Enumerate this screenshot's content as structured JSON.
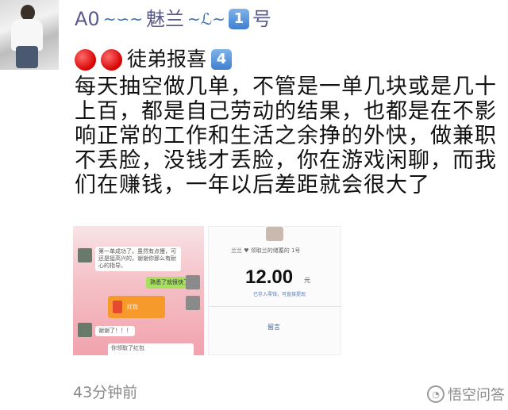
{
  "post": {
    "avatar_icon": "user-avatar-photo",
    "author": {
      "prefix": "A0",
      "deco1": "~∽~",
      "mid": "魅兰",
      "deco2": "~ℒ~",
      "number_badge": "1",
      "suffix": "号"
    },
    "tag": {
      "text": "徒弟报喜",
      "badge": "4"
    },
    "body_lines": [
      "每天抽空做几单，不管是一单几块或是几十",
      "上百，都是自己劳动的结果，也都是在不影",
      "响正常的工作和生活之余挣的外快，做兼职",
      "不丢脸，没钱才丢脸，你在游戏闲聊，而我",
      "们在赚钱，一年以后差距就会很大了"
    ],
    "images": {
      "left": {
        "top_text": "第一单成功了。虽然有点慢，可还是挺高兴的，谢谢你那么有耐心的指导。",
        "green_text": "熟悉了就很快了",
        "red_packet_text": "红包",
        "reply": "谢谢了！！！",
        "footer_text": "你领取了红包"
      },
      "right": {
        "subtitle": "兰兰 ♥ 领取兰的储蓄的 1号",
        "amount": "12.00",
        "unit": "元",
        "note": "已存入零钱，可直接提现",
        "link": "留言"
      }
    },
    "time": "43分钟前",
    "watermark": "悟空问答",
    "watermark_icon": "wukong-logo-icon"
  }
}
